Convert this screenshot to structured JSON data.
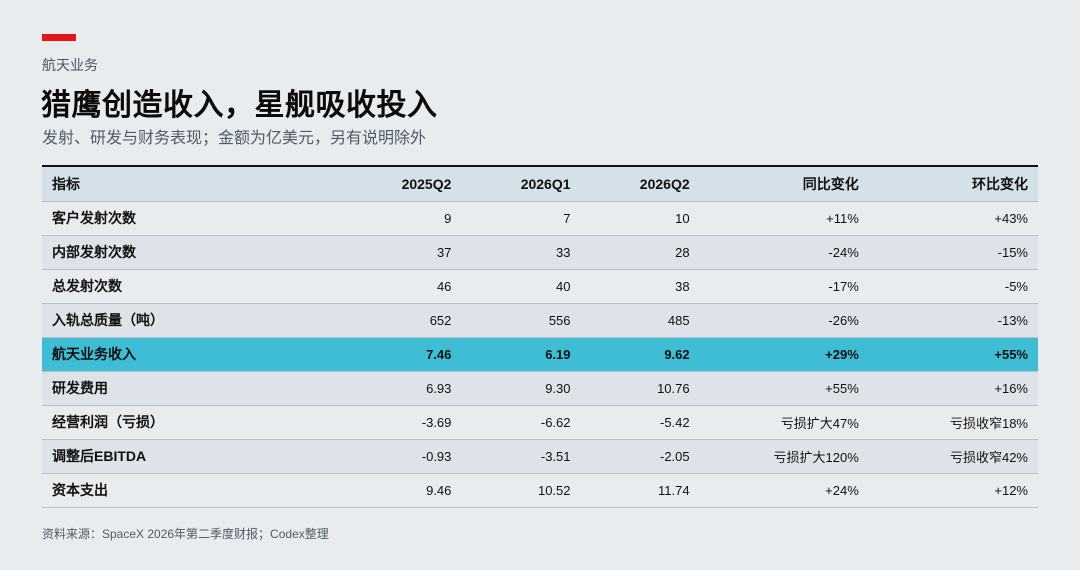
{
  "header": {
    "section_label": "航天业务",
    "title": "猎鹰创造收入，星舰吸收投入",
    "subtitle": "发射、研发与财务表现；金额为亿美元，另有说明除外",
    "accent_color": "#e4141b"
  },
  "table": {
    "columns": [
      "指标",
      "2025Q2",
      "2026Q1",
      "2026Q2",
      "同比变化",
      "环比变化"
    ],
    "rows": [
      {
        "metric": "客户发射次数",
        "q2025q2": "9",
        "q2026q1": "7",
        "q2026q2": "10",
        "yoy": "+11%",
        "qoq": "+43%"
      },
      {
        "metric": "内部发射次数",
        "q2025q2": "37",
        "q2026q1": "33",
        "q2026q2": "28",
        "yoy": "-24%",
        "qoq": "-15%"
      },
      {
        "metric": "总发射次数",
        "q2025q2": "46",
        "q2026q1": "40",
        "q2026q2": "38",
        "yoy": "-17%",
        "qoq": "-5%"
      },
      {
        "metric": "入轨总质量（吨）",
        "q2025q2": "652",
        "q2026q1": "556",
        "q2026q2": "485",
        "yoy": "-26%",
        "qoq": "-13%"
      },
      {
        "metric": "航天业务收入",
        "q2025q2": "7.46",
        "q2026q1": "6.19",
        "q2026q2": "9.62",
        "yoy": "+29%",
        "qoq": "+55%"
      },
      {
        "metric": "研发费用",
        "q2025q2": "6.93",
        "q2026q1": "9.30",
        "q2026q2": "10.76",
        "yoy": "+55%",
        "qoq": "+16%"
      },
      {
        "metric": "经营利润（亏损）",
        "q2025q2": "-3.69",
        "q2026q1": "-6.62",
        "q2026q2": "-5.42",
        "yoy": "亏损扩大47%",
        "qoq": "亏损收窄18%"
      },
      {
        "metric": "调整后EBITDA",
        "q2025q2": "-0.93",
        "q2026q1": "-3.51",
        "q2026q2": "-2.05",
        "yoy": "亏损扩大120%",
        "qoq": "亏损收窄42%"
      },
      {
        "metric": "资本支出",
        "q2025q2": "9.46",
        "q2026q1": "10.52",
        "q2026q2": "11.74",
        "yoy": "+24%",
        "qoq": "+12%"
      }
    ],
    "highlight_color": "#3fbdd5"
  },
  "footer": {
    "source": "资料来源：SpaceX 2026年第二季度财报；Codex整理"
  }
}
